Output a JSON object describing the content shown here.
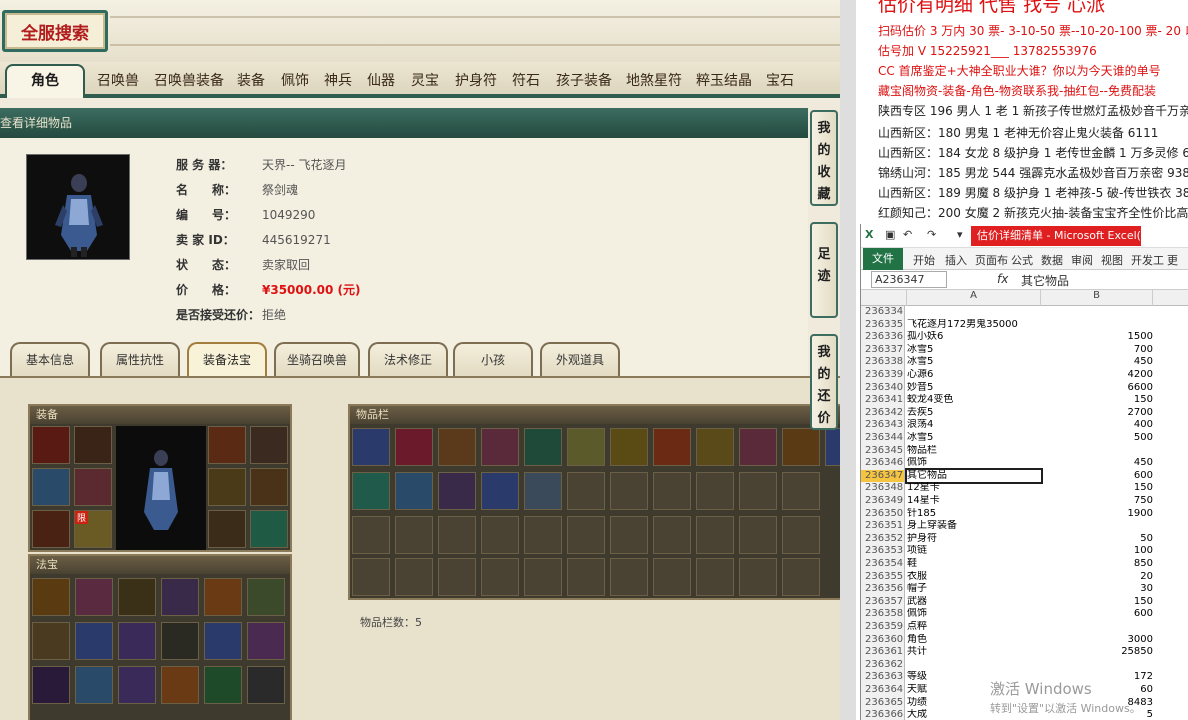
{
  "app": {
    "logo": "全服搜索"
  },
  "tabs": [
    "角色",
    "召唤兽",
    "召唤兽装备",
    "装备",
    "佩饰",
    "神兵",
    "仙器",
    "灵宝",
    "护身符",
    "符石",
    "孩子装备",
    "地煞星符",
    "粹玉结晶",
    "宝石"
  ],
  "panel": {
    "title": "查看详细物品"
  },
  "info": {
    "server_label": "服 务 器：",
    "server_value": "天界-- 飞花逐月",
    "name_label": "名　　称：",
    "name_value": "祭剑魂",
    "id_label": "编　　号：",
    "id_value": "1049290",
    "seller_label": "卖 家 ID：",
    "seller_value": "445619271",
    "status_label": "状　　态：",
    "status_value": "卖家取回",
    "price_label": "价　　格：",
    "price_value": "¥35000.00 (元)",
    "bargain_label": "是否接受还价：",
    "bargain_value": "拒绝"
  },
  "subtabs": [
    "基本信息",
    "属性抗性",
    "装备法宝",
    "坐骑召唤兽",
    "法术修正",
    "小孩",
    "外观道具"
  ],
  "boxes": {
    "equip": "装备",
    "treasure": "法宝",
    "inventory": "物品栏",
    "inventory_count": "物品栏数：5"
  },
  "badge": "限",
  "sidebtns": [
    "我的收藏",
    "足迹",
    "我的还价"
  ],
  "ad": {
    "title": "估价有明细 代售 找号 心派",
    "lines": [
      {
        "text": "扫码估价 3 万内 30 票- 3-10-50 票--10-20-100 票- 20 以上 150-",
        "color": "red"
      },
      {
        "text": "估号加 V 15225921___ 13782553976",
        "color": "red"
      },
      {
        "text": "CC 首席鉴定+大神全职业大谁？你以为今天谁的单号",
        "color": "red"
      },
      {
        "text": "藏宝阁物资-装备-角色-物资联系我-抽红包--免费配装",
        "color": "red"
      },
      {
        "text": "陕西专区 196 男人 1 老 1 新孩子传世燃灯孟极妙音千万亲密 3",
        "color": "dark"
      },
      {
        "text": "山西新区：180 男鬼 1 老神无价容止鬼火装备 6111",
        "color": "dark"
      },
      {
        "text": "山西新区：184 女龙 8 级护身 1 老传世金麟 1 万多灵修 6111",
        "color": "dark"
      },
      {
        "text": "锦绣山河：185 男龙 544 强霹克水孟极妙音百万亲密 93888",
        "color": "dark"
      },
      {
        "text": "山西新区：189 男魔 8 级护身 1 老神孩-5 破-传世铁衣 38000",
        "color": "dark"
      },
      {
        "text": "红颜知己：200 女魔 2 新孩克火抽-装备宝宝齐全性价比高 200",
        "color": "dark"
      }
    ]
  },
  "excel": {
    "title": "估价详细清单 - Microsoft Excel(产品...",
    "ribbon": [
      "文件",
      "开始",
      "插入",
      "页面布",
      "公式",
      "数据",
      "审阅",
      "视图",
      "开发工",
      "更多"
    ],
    "namebox": "A236347",
    "fx": "fx",
    "formula": "其它物品",
    "cols": [
      "A",
      "B"
    ],
    "rows": [
      [
        "236334",
        "",
        ""
      ],
      [
        "236335",
        "飞花逐月172男鬼35000",
        ""
      ],
      [
        "236336",
        "孤小妖6",
        "1500"
      ],
      [
        "236337",
        "冰雪5",
        "700"
      ],
      [
        "236338",
        "冰雪5",
        "450"
      ],
      [
        "236339",
        "心源6",
        "4200"
      ],
      [
        "236340",
        "妙音5",
        "6600"
      ],
      [
        "236341",
        "蛟龙4变色",
        "150"
      ],
      [
        "236342",
        "去疾5",
        "2700"
      ],
      [
        "236343",
        "浪荡4",
        "400"
      ],
      [
        "236344",
        "冰雪5",
        "500"
      ],
      [
        "236345",
        "物品栏",
        ""
      ],
      [
        "236346",
        "佩饰",
        "450"
      ],
      [
        "236347",
        "其它物品",
        "600"
      ],
      [
        "236348",
        "12星卡",
        "150"
      ],
      [
        "236349",
        "14星卡",
        "750"
      ],
      [
        "236350",
        "针185",
        "1900"
      ],
      [
        "236351",
        "身上穿装备",
        ""
      ],
      [
        "236352",
        "护身符",
        "50"
      ],
      [
        "236353",
        "项链",
        "100"
      ],
      [
        "236354",
        "鞋",
        "850"
      ],
      [
        "236355",
        "衣服",
        "20"
      ],
      [
        "236356",
        "帽子",
        "30"
      ],
      [
        "236357",
        "武器",
        "150"
      ],
      [
        "236358",
        "佩饰",
        "600"
      ],
      [
        "236359",
        "点粹",
        ""
      ],
      [
        "236360",
        "角色",
        "3000"
      ],
      [
        "236361",
        "共计",
        "25850"
      ],
      [
        "236362",
        "",
        ""
      ],
      [
        "236363",
        "等级",
        "172"
      ],
      [
        "236364",
        "天赋",
        "60"
      ],
      [
        "236365",
        "功绩",
        "8483"
      ],
      [
        "236366",
        "大成",
        "5"
      ]
    ]
  },
  "watermark": {
    "line1": "激活 Windows",
    "line2": "转到\"设置\"以激活 Windows。"
  },
  "colors": {
    "accent": "#2f5c4f",
    "price": "#dd1111",
    "excel": "#217346"
  }
}
